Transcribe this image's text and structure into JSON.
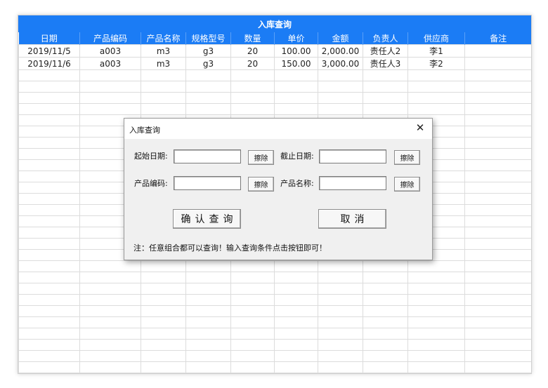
{
  "sheet": {
    "title": "入库查询",
    "columns": [
      "日期",
      "产品编码",
      "产品名称",
      "规格型号",
      "数量",
      "单价",
      "金额",
      "负责人",
      "供应商",
      "备注"
    ],
    "rows": [
      [
        "2019/11/5",
        "a003",
        "m3",
        "g3",
        "20",
        "100.00",
        "2,000.00",
        "责任人2",
        "李1",
        ""
      ],
      [
        "2019/11/6",
        "a003",
        "m3",
        "g3",
        "20",
        "150.00",
        "3,000.00",
        "责任人3",
        "李2",
        ""
      ]
    ]
  },
  "dialog": {
    "title": "入库查询",
    "close_glyph": "✕",
    "start_date_label": "起始日期:",
    "end_date_label": "截止日期:",
    "product_code_label": "产品编码:",
    "product_name_label": "产品名称:",
    "start_date_value": "",
    "end_date_value": "",
    "product_code_value": "",
    "product_name_value": "",
    "clear_label": "擦除",
    "confirm_label": "确认查询",
    "cancel_label": "取消",
    "note": "注：任意组合都可以查询！输入查询条件点击按钮即可！"
  },
  "colors": {
    "header_blue": "#1b7cf5",
    "dialog_bg": "#f0f0f0"
  }
}
